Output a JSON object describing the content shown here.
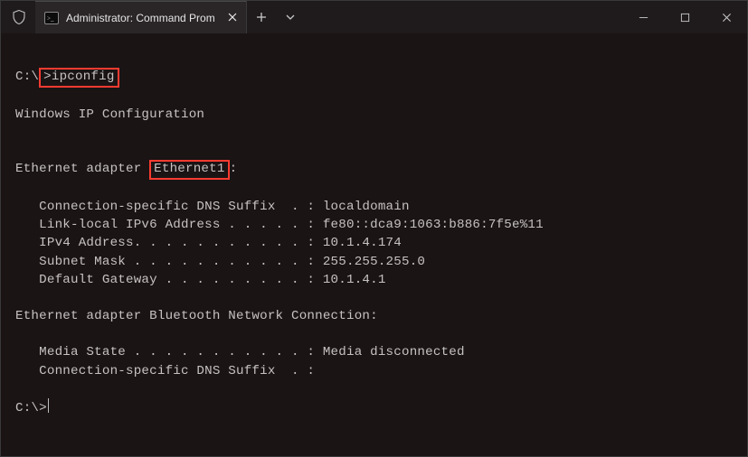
{
  "titlebar": {
    "tab_title": "Administrator: Command Prom",
    "icon": "cmd-icon",
    "shield": "shield-icon"
  },
  "terminal": {
    "prompt1_pre": "C:\\",
    "prompt1_cmd": ">ipconfig",
    "header": "Windows IP Configuration",
    "adapter1_pre": "Ethernet adapter ",
    "adapter1_name": "Ethernet1",
    "adapter1_post": ":",
    "a1_dns": "   Connection-specific DNS Suffix  . : localdomain",
    "a1_ipv6": "   Link-local IPv6 Address . . . . . : fe80::dca9:1063:b886:7f5e%11",
    "a1_ipv4": "   IPv4 Address. . . . . . . . . . . : 10.1.4.174",
    "a1_mask": "   Subnet Mask . . . . . . . . . . . : 255.255.255.0",
    "a1_gw": "   Default Gateway . . . . . . . . . : 10.1.4.1",
    "adapter2_line": "Ethernet adapter Bluetooth Network Connection:",
    "a2_media": "   Media State . . . . . . . . . . . : Media disconnected",
    "a2_dns": "   Connection-specific DNS Suffix  . :",
    "prompt2": "C:\\>"
  }
}
